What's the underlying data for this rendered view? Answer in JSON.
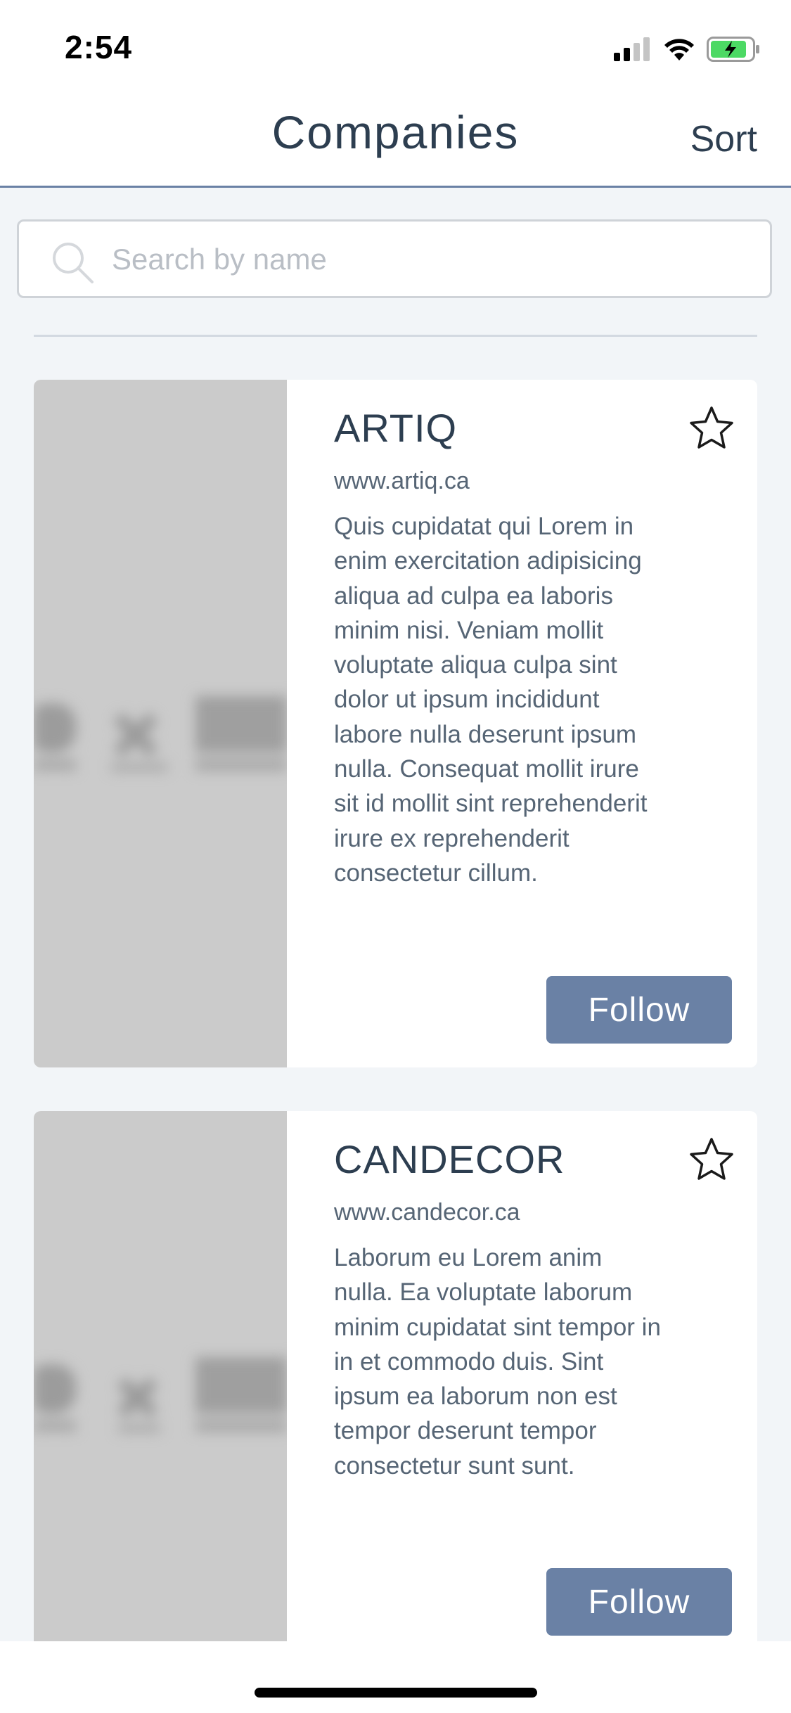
{
  "status_bar": {
    "time": "2:54"
  },
  "nav": {
    "title": "Companies",
    "sort_label": "Sort"
  },
  "search": {
    "placeholder": "Search by name",
    "value": ""
  },
  "companies": [
    {
      "name": "ARTIQ",
      "url": "www.artiq.ca",
      "description": "Quis cupidatat qui Lorem in enim exercitation adipisicing aliqua ad culpa ea laboris minim nisi. Veniam mollit voluptate aliqua culpa sint dolor ut ipsum incididunt labore nulla deserunt ipsum nulla. Consequat mollit irure sit id mollit sint reprehenderit irure ex reprehenderit consectetur cillum.",
      "follow_label": "Follow",
      "favorite": false
    },
    {
      "name": "CANDECOR",
      "url": "www.candecor.ca",
      "description": "Laborum eu Lorem anim nulla. Ea voluptate laborum minim cupidatat sint tempor in in et commodo duis. Sint ipsum ea laborum non est tempor deserunt tempor consectetur sunt sunt.",
      "follow_label": "Follow",
      "favorite": false
    }
  ],
  "icons": {
    "search": "search-icon",
    "favorite": "star-outline-icon",
    "signal": "cellular-signal-icon",
    "wifi": "wifi-icon",
    "battery": "battery-charging-icon"
  },
  "colors": {
    "accent": "#6a81a5",
    "title_text": "#2d3e50",
    "body_text": "#566575",
    "background": "#f2f5f8",
    "image_placeholder": "#cbcbcb",
    "battery_green": "#4cd964"
  }
}
